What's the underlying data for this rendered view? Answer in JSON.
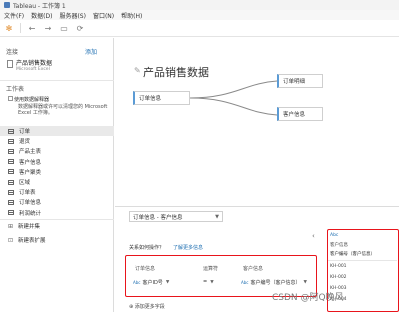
{
  "window": {
    "title": "Tableau - 工作簿 1"
  },
  "menu": {
    "items": [
      "文件(F)",
      "数据(D)",
      "服务器(S)",
      "窗口(N)",
      "帮助(H)"
    ]
  },
  "sidebar": {
    "connections_label": "连接",
    "add_label": "添加",
    "datasource": {
      "name": "产品销售数据",
      "type": "Microsoft Excel"
    },
    "sheets_label": "工作表",
    "interpreter": {
      "title": "使用数据解释器",
      "desc": "数据解释器或许可以清理您的 Microsoft Excel 工作簿。"
    },
    "sheets": [
      "订单",
      "退货",
      "产品主表",
      "客户信息",
      "客户聚类",
      "区域",
      "订单表",
      "订单信息",
      "利润统计"
    ],
    "new_union": "新建并集",
    "new_table_ext": "新建表扩展"
  },
  "canvas": {
    "title": "产品销售数据",
    "tables": {
      "left": "订单信息",
      "top_right": "订单明细",
      "bottom_right": "客户信息"
    }
  },
  "lower": {
    "dropdown_value": "订单信息 - 客户信息",
    "question": "关系如何操作？",
    "link": "了解更多信息",
    "headers": [
      "订单信息",
      "运算符",
      "客户信息"
    ],
    "values": [
      "客户ID号",
      "=",
      "客户编号（客户信息）"
    ],
    "add_more": "添加更多字段"
  },
  "right_panel": {
    "rows": [
      "Abc",
      "客户信息",
      "客户编号（客户信息）",
      "KH-001",
      "KH-002",
      "KH-003",
      "KH-004"
    ]
  },
  "watermark": "CSDN @阿Q晚风",
  "colors": {
    "accent": "#1f6fb2",
    "highlight": "#e8141b",
    "node_stripe": "#5b9bd5"
  }
}
